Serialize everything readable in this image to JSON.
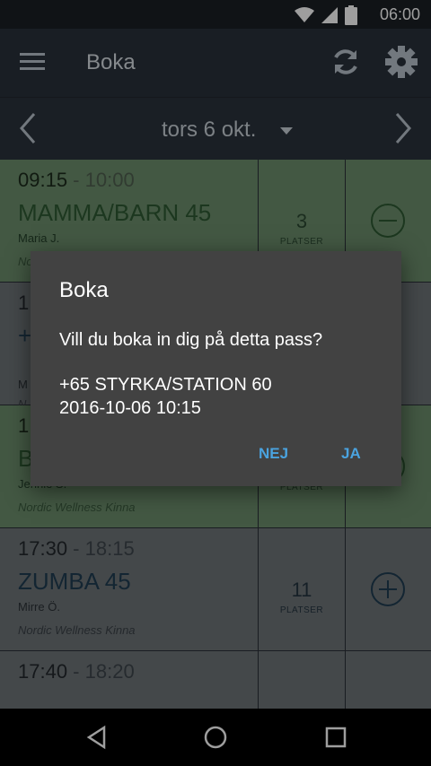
{
  "status": {
    "time": "06:00",
    "battery": "100"
  },
  "appbar": {
    "title": "Boka"
  },
  "datebar": {
    "date": "tors 6 okt."
  },
  "rows": [
    {
      "start": "09:15",
      "end": "10:00",
      "sep": " - ",
      "cls": "MAMMA/BARN 45",
      "instructor": "Maria J.",
      "location": "No",
      "seats": "3",
      "seats_label": "PLATSER",
      "action": "minus"
    },
    {
      "start": "1",
      "end": "",
      "sep": "",
      "cls": "+",
      "instructor": "M",
      "location": "N",
      "seats": "",
      "seats_label": "",
      "action": ""
    },
    {
      "start": "1",
      "end": "",
      "sep": "",
      "cls": "BODYPUMP 55",
      "instructor": "Jennie S.",
      "location": "Nordic Wellness Kinna",
      "seats": "23",
      "seats_label": "PLATSER",
      "action": "minus"
    },
    {
      "start": "17:30",
      "end": "18:15",
      "sep": " - ",
      "cls": "ZUMBA 45",
      "instructor": "Mirre Ö.",
      "location": "Nordic Wellness Kinna",
      "seats": "11",
      "seats_label": "PLATSER",
      "action": "plus"
    },
    {
      "start": "17:40",
      "end": "18:20",
      "sep": " - ",
      "cls": "",
      "instructor": "",
      "location": "",
      "seats": "",
      "seats_label": "",
      "action": ""
    }
  ],
  "dialog": {
    "title": "Boka",
    "message": "Vill du boka in dig på detta pass?",
    "class_name": "+65 STYRKA/STATION 60",
    "datetime": "2016-10-06 10:15",
    "no_label": "NEJ",
    "yes_label": "JA"
  },
  "colors": {
    "accent": "#4aa3df",
    "booked": "#6c8f6c",
    "available": "#6f7478",
    "dialog": "#424242"
  }
}
